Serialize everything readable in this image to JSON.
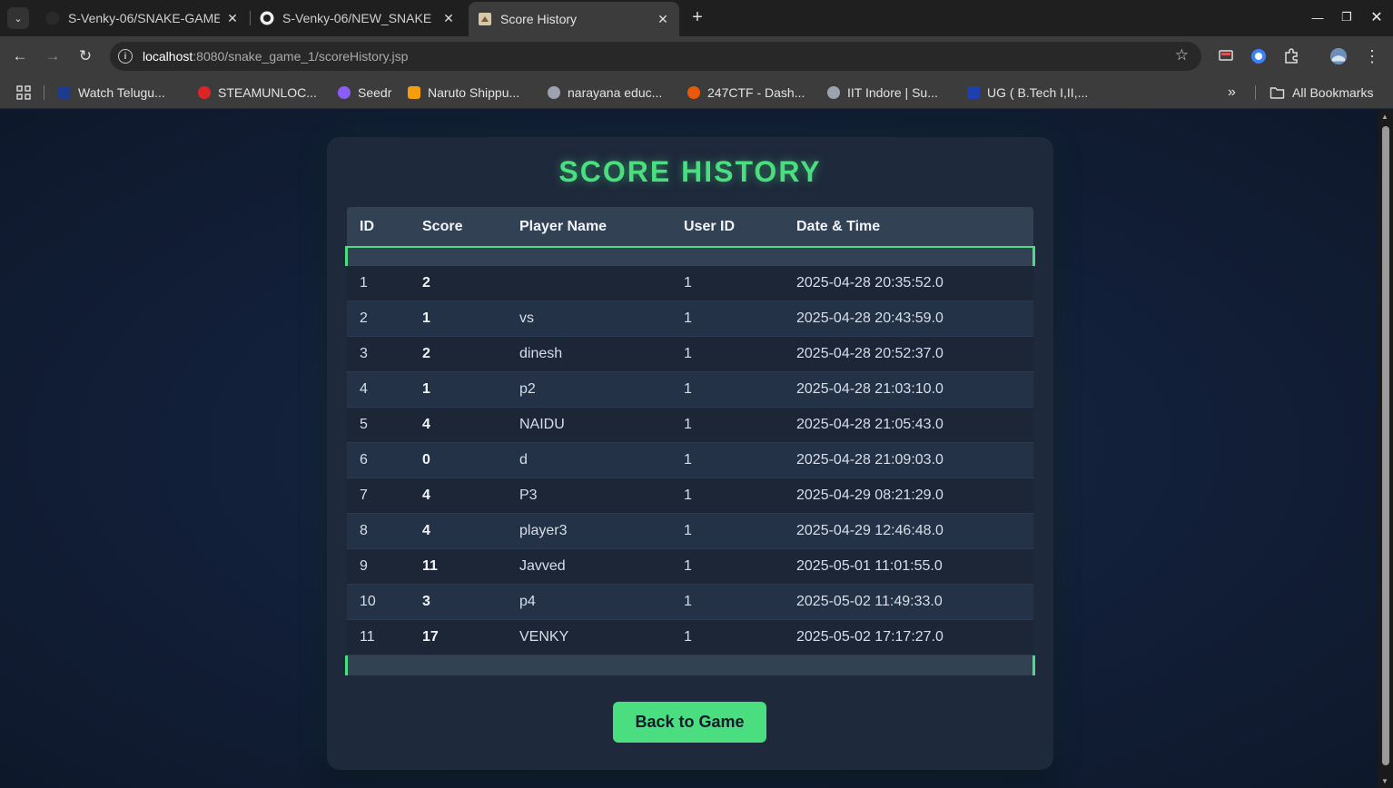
{
  "browser": {
    "tabs": [
      {
        "title": "S-Venky-06/SNAKE-GAME",
        "active": false
      },
      {
        "title": "S-Venky-06/NEW_SNAKE",
        "active": false
      },
      {
        "title": "Score History",
        "active": true
      }
    ],
    "new_tab_label": "+",
    "url_host": "localhost",
    "url_rest": ":8080/snake_game_1/scoreHistory.jsp",
    "bookmarks": [
      {
        "label": "Watch Telugu...",
        "icon": "#1e3a8a"
      },
      {
        "label": "STEAMUNLOC...",
        "icon": "#dc2626"
      },
      {
        "label": "Seedr",
        "icon": "#8b5cf6"
      },
      {
        "label": "Naruto Shippu...",
        "icon": "#f59e0b"
      },
      {
        "label": "narayana educ...",
        "icon": "#9ca3af"
      },
      {
        "label": "247CTF - Dash...",
        "icon": "#ea580c"
      },
      {
        "label": "IIT Indore | Su...",
        "icon": "#9ca3af"
      },
      {
        "label": "UG ( B.Tech I,II,...",
        "icon": "#1e40af"
      }
    ],
    "all_bookmarks_label": "All Bookmarks"
  },
  "page": {
    "title": "SCORE HISTORY",
    "columns": {
      "id": "ID",
      "score": "Score",
      "player": "Player Name",
      "user_id": "User ID",
      "date": "Date & Time"
    },
    "rows": [
      {
        "id": "1",
        "score": "2",
        "player": "",
        "user_id": "1",
        "date": "2025-04-28 20:35:52.0"
      },
      {
        "id": "2",
        "score": "1",
        "player": "vs",
        "user_id": "1",
        "date": "2025-04-28 20:43:59.0"
      },
      {
        "id": "3",
        "score": "2",
        "player": "dinesh",
        "user_id": "1",
        "date": "2025-04-28 20:52:37.0"
      },
      {
        "id": "4",
        "score": "1",
        "player": "p2",
        "user_id": "1",
        "date": "2025-04-28 21:03:10.0"
      },
      {
        "id": "5",
        "score": "4",
        "player": "NAIDU",
        "user_id": "1",
        "date": "2025-04-28 21:05:43.0"
      },
      {
        "id": "6",
        "score": "0",
        "player": "d",
        "user_id": "1",
        "date": "2025-04-28 21:09:03.0"
      },
      {
        "id": "7",
        "score": "4",
        "player": "P3",
        "user_id": "1",
        "date": "2025-04-29 08:21:29.0"
      },
      {
        "id": "8",
        "score": "4",
        "player": "player3",
        "user_id": "1",
        "date": "2025-04-29 12:46:48.0"
      },
      {
        "id": "9",
        "score": "11",
        "player": "Javved",
        "user_id": "1",
        "date": "2025-05-01 11:01:55.0"
      },
      {
        "id": "10",
        "score": "3",
        "player": "p4",
        "user_id": "1",
        "date": "2025-05-02 11:49:33.0"
      },
      {
        "id": "11",
        "score": "17",
        "player": "VENKY",
        "user_id": "1",
        "date": "2025-05-02 17:17:27.0"
      }
    ],
    "back_button_label": "Back to Game",
    "accent_color": "#4ade80",
    "card_color": "#1e293b"
  }
}
